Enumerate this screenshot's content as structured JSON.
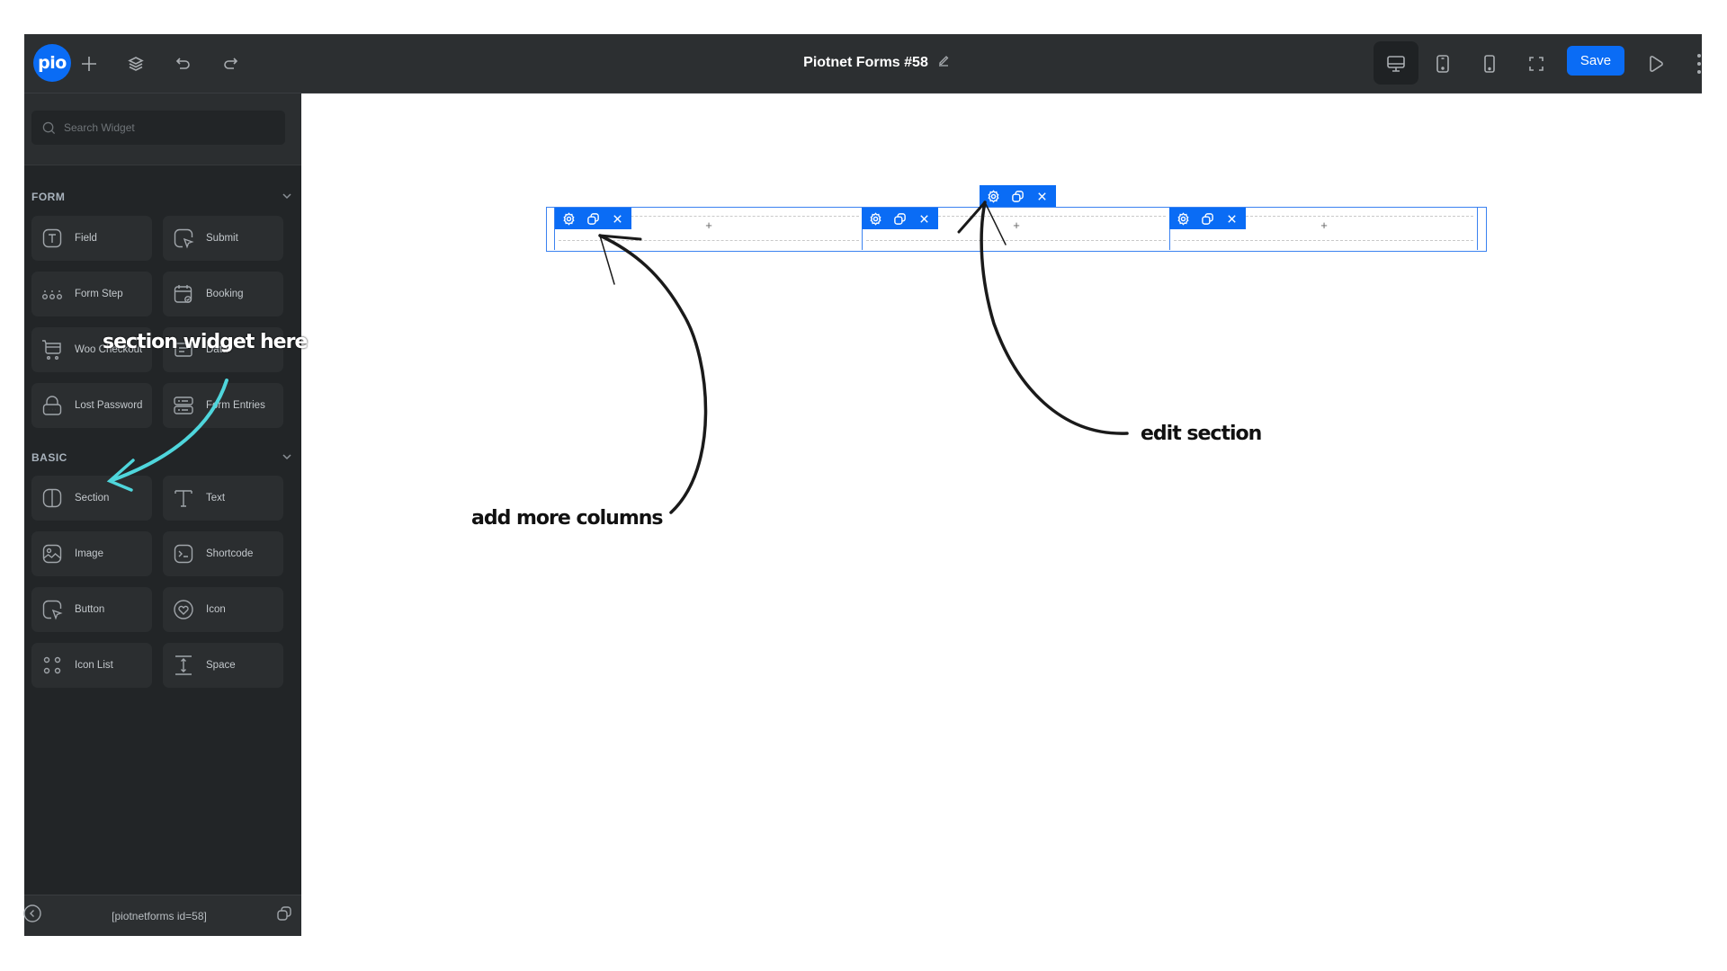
{
  "app": {
    "logo_text": "pio",
    "title": "Piotnet Forms #58",
    "save_label": "Save",
    "topbar_icons": [
      "add-icon",
      "layers-icon",
      "undo-icon",
      "redo-icon"
    ],
    "device_icons": [
      "desktop-icon",
      "tablet-icon",
      "mobile-icon",
      "fullscreen-icon"
    ],
    "active_device": "desktop"
  },
  "sidebar": {
    "search_placeholder": "Search Widget",
    "categories": [
      {
        "title": "FORM",
        "widgets": [
          {
            "label": "Field",
            "icon": "field-icon"
          },
          {
            "label": "Submit",
            "icon": "submit-icon"
          },
          {
            "label": "Form Step",
            "icon": "form-step-icon"
          },
          {
            "label": "Booking",
            "icon": "booking-icon"
          },
          {
            "label": "Woo Checkout",
            "icon": "cart-icon"
          },
          {
            "label": "Data",
            "icon": "data-icon"
          },
          {
            "label": "Lost Password",
            "icon": "lock-icon"
          },
          {
            "label": "Form Entries",
            "icon": "entries-icon"
          }
        ]
      },
      {
        "title": "BASIC",
        "widgets": [
          {
            "label": "Section",
            "icon": "section-icon"
          },
          {
            "label": "Text",
            "icon": "text-icon"
          },
          {
            "label": "Image",
            "icon": "image-icon"
          },
          {
            "label": "Shortcode",
            "icon": "shortcode-icon"
          },
          {
            "label": "Button",
            "icon": "button-icon"
          },
          {
            "label": "Icon",
            "icon": "heart-icon"
          },
          {
            "label": "Icon List",
            "icon": "icon-list-icon"
          },
          {
            "label": "Space",
            "icon": "space-icon"
          }
        ]
      }
    ],
    "footer_shortcode": "[piotnetforms id=58]"
  },
  "canvas": {
    "section": {
      "columns": [
        {
          "add_label": "+"
        },
        {
          "add_label": "+"
        },
        {
          "add_label": "+"
        }
      ]
    }
  },
  "annotations": {
    "section_widget": "section widget here",
    "add_columns": "add more columns",
    "edit_section": "edit section"
  },
  "colors": {
    "accent": "#0a6cf5",
    "arrow_cyan": "#4fd6dc"
  }
}
